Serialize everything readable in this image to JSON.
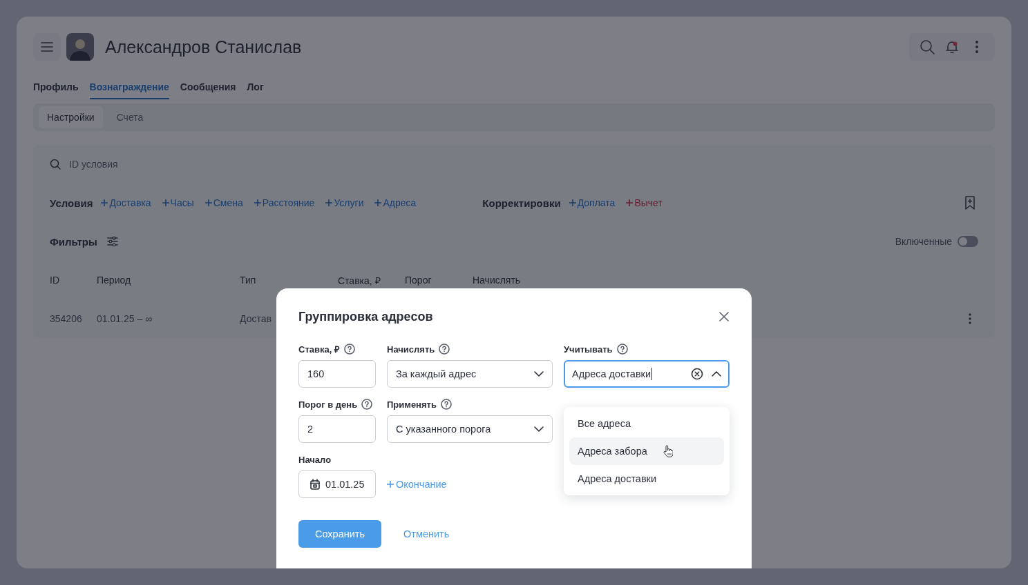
{
  "header": {
    "title": "Александров Станислав"
  },
  "tabs": [
    {
      "label": "Профиль",
      "selected": false
    },
    {
      "label": "Вознаграждение",
      "selected": true
    },
    {
      "label": "Сообщения",
      "selected": false
    },
    {
      "label": "Лог",
      "selected": false
    }
  ],
  "subtabs": [
    {
      "label": "Настройки",
      "selected": true
    },
    {
      "label": "Счета",
      "selected": false
    }
  ],
  "search": {
    "placeholder": "ID условия"
  },
  "conditions": {
    "title": "Условия",
    "links": [
      {
        "label": "Доставка",
        "kind": "add"
      },
      {
        "label": "Часы",
        "kind": "add"
      },
      {
        "label": "Смена",
        "kind": "add"
      },
      {
        "label": "Расстояние",
        "kind": "add"
      },
      {
        "label": "Услуги",
        "kind": "add"
      },
      {
        "label": "Адреса",
        "kind": "add"
      }
    ]
  },
  "adjustments": {
    "title": "Корректировки",
    "links": [
      {
        "label": "Доплата",
        "kind": "add"
      },
      {
        "label": "Вычет",
        "kind": "deduct"
      }
    ]
  },
  "filters": {
    "title": "Фильтры",
    "toggle_label": "Включенные",
    "on": false
  },
  "table": {
    "columns": [
      "ID",
      "Период",
      "Тип",
      "Ставка, ₽",
      "Порог",
      "Начислять"
    ],
    "rows": [
      {
        "cells": [
          "354206",
          "01.01.25 – ∞",
          "Достав"
        ]
      }
    ]
  },
  "modal": {
    "title": "Группировка адресов",
    "rows": [
      {
        "fields": [
          {
            "kind": "input",
            "label": "Ставка, ₽",
            "value": "160"
          },
          {
            "kind": "select",
            "label": "Начислять",
            "value": "За каждый адрес",
            "expanded": false
          },
          {
            "kind": "select",
            "label": "Учитывать",
            "value": "Адреса доставки",
            "expanded": true,
            "focused": true,
            "options": [
              {
                "label": "Все адреса",
                "highlighted": false
              },
              {
                "label": "Адреса забора",
                "highlighted": true
              },
              {
                "label": "Адреса доставки",
                "highlighted": false
              }
            ]
          }
        ]
      },
      {
        "fields": [
          {
            "kind": "input",
            "label": "Порог в день",
            "value": "2"
          },
          {
            "kind": "select",
            "label": "Применять",
            "value": "С указанного порога",
            "expanded": false
          }
        ]
      },
      {
        "fields": [
          {
            "kind": "date",
            "label": "Начало",
            "value": "01.01.25"
          }
        ],
        "end_link": "Окончание"
      }
    ],
    "save": "Сохранить",
    "cancel": "Отменить"
  }
}
